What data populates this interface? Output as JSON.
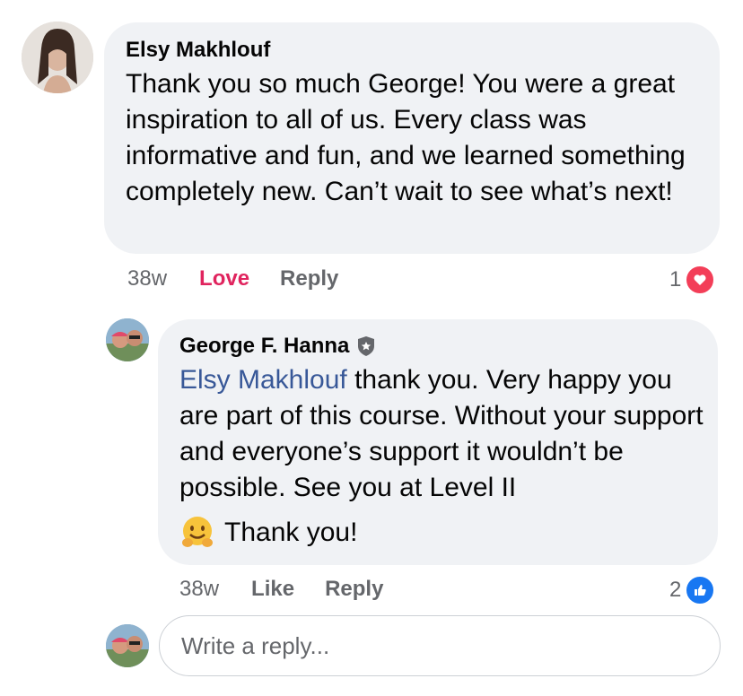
{
  "comments": [
    {
      "author": "Elsy Makhlouf",
      "text": "Thank you so much George! You were a great inspiration to all of us. Every class was informative and fun, and we learned something completely new. Can’t wait to see what’s next!",
      "time": "38w",
      "love_label": "Love",
      "reply_label": "Reply",
      "reaction_count": "1",
      "reaction_icon": "heart-reaction-icon"
    },
    {
      "author": "George F. Hanna",
      "author_badge_icon": "shield-badge-icon",
      "mention": "Elsy Makhlouf",
      "text": " thank you. Very happy you are part of this course. Without your support and everyone’s support it wouldn’t be possible. See you at Level II",
      "thanks_text": "Thank you!",
      "emoji_icon": "hugging-face-emoji-icon",
      "time": "38w",
      "like_label": "Like",
      "reply_label": "Reply",
      "reaction_count": "2",
      "reaction_icon": "thumbs-up-reaction-icon"
    }
  ],
  "reply_box": {
    "placeholder": "Write a reply..."
  },
  "colors": {
    "bubble": "#f0f2f5",
    "love": "#e0245e",
    "mention": "#385898",
    "like_blue": "#1877f2",
    "heart_red": "#f33e58"
  }
}
